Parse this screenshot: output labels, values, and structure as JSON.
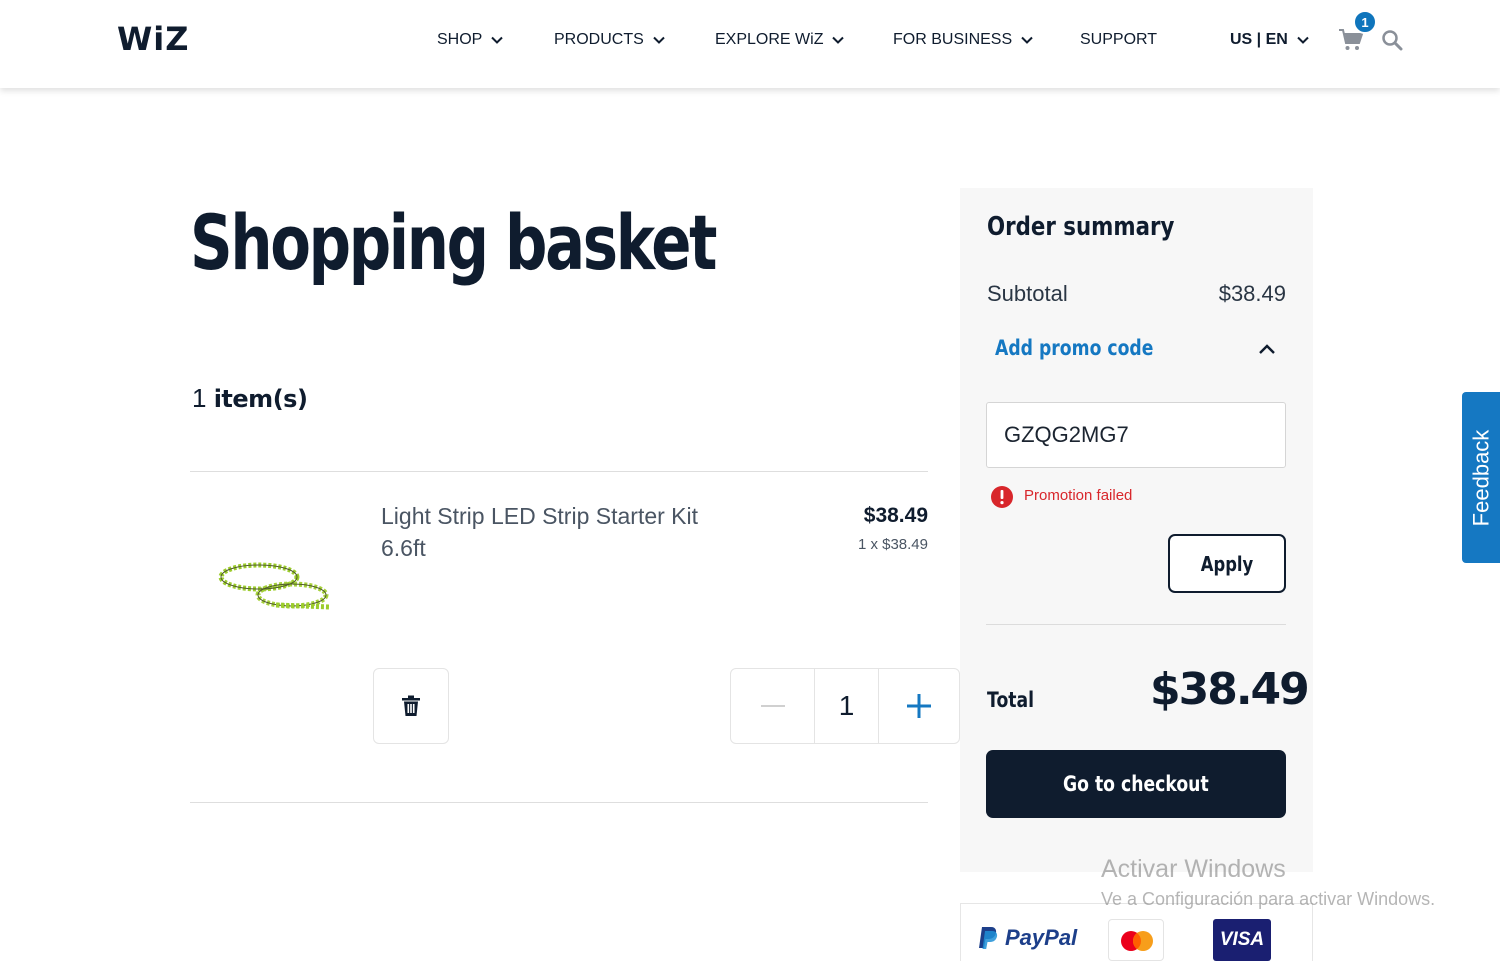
{
  "header": {
    "logo": "WiZ",
    "nav": [
      {
        "label": "SHOP",
        "has_dropdown": true
      },
      {
        "label": "PRODUCTS",
        "has_dropdown": true
      },
      {
        "label": "EXPLORE WiZ",
        "has_dropdown": true
      },
      {
        "label": "FOR BUSINESS",
        "has_dropdown": true
      },
      {
        "label": "SUPPORT",
        "has_dropdown": false
      }
    ],
    "locale": "US | EN",
    "cart_count": "1",
    "icons": [
      "chevron-down-icon",
      "cart-icon",
      "search-icon"
    ],
    "accent_color": "#0f75bc"
  },
  "basket": {
    "title": "Shopping basket",
    "item_count": "1",
    "item_count_label": "item(s)",
    "items": [
      {
        "name": "Light Strip LED Strip Starter Kit 6.6ft",
        "price": "$38.49",
        "unit_line": "1 x $38.49",
        "quantity": "1"
      }
    ],
    "icons": [
      "trash-icon",
      "minus-icon",
      "plus-icon"
    ]
  },
  "summary": {
    "title": "Order summary",
    "subtotal_label": "Subtotal",
    "subtotal_value": "$38.49",
    "promo_link": "Add promo code",
    "promo_value": "GZQG2MG7",
    "promo_error": "Promotion failed",
    "apply_label": "Apply",
    "total_label": "Total",
    "total_value": "$38.49",
    "checkout_label": "Go to checkout",
    "error_color": "#d8262b",
    "link_color": "#1578c2",
    "dark_color": "#0f1c2e"
  },
  "payments": {
    "paypal": "PayPal",
    "visa": "VISA",
    "mastercard_icon": "mastercard-icon"
  },
  "feedback_label": "Feedback",
  "watermark": {
    "title": "Activar Windows",
    "subtitle": "Ve a Configuración para activar Windows."
  }
}
